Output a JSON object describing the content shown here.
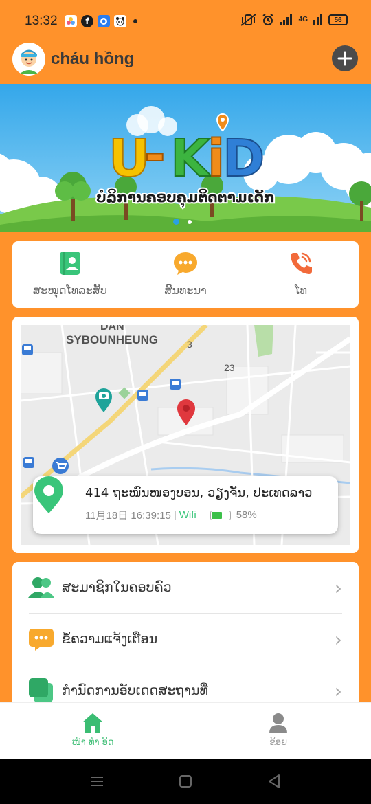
{
  "status_bar": {
    "time": "13:32",
    "app_icons": [
      "photos-app-icon",
      "facebook-icon",
      "messenger-app-icon",
      "panda-app-icon"
    ],
    "network": "4G",
    "battery": "56"
  },
  "header": {
    "child_name": "cháu hồng"
  },
  "banner": {
    "logo_text": "U-KiD",
    "tagline": "ບໍລິການຄອບຄຸມຕິດຕາມເດັກ",
    "active_slide": 1,
    "slide_count": 2
  },
  "quick_actions": [
    {
      "label": "ສະໝຸດໂທລະສັບ",
      "icon": "contacts-book-icon",
      "color": "#39c57a"
    },
    {
      "label": "ສົນທະນາ",
      "icon": "chat-bubble-icon",
      "color": "#f8a92d"
    },
    {
      "label": "ໂທ",
      "icon": "phone-icon",
      "color": "#f26a3a"
    }
  ],
  "map": {
    "labels": {
      "district": "DAN",
      "area": "SYBOUNHEUNG",
      "road_1": "3",
      "road_2": "23"
    },
    "location": {
      "address": "414 ຖະໜົນໜອງບອນ, ວຽງຈັນ, ປະເທດລາວ",
      "date": "11月18日 16:39:15",
      "separator": "|",
      "connection": "Wifi",
      "battery_level": 0.58,
      "battery_text": "58%"
    }
  },
  "menu": [
    {
      "label": "ສະມາຊິກໃນຄອບຄົວ",
      "icon": "family-members-icon"
    },
    {
      "label": "ຂໍ້ຄວາມແຈ້ງເຕືອນ",
      "icon": "notification-message-icon"
    },
    {
      "label": "ກຳນົດການອັບເດດສະຖານທີ່",
      "icon": "location-update-schedule-icon"
    }
  ],
  "bottom_nav": [
    {
      "label": "ໜ້າ ທຳ ອິດ",
      "icon": "home-icon",
      "active": true
    },
    {
      "label": "ຂ້ອຍ",
      "icon": "profile-icon",
      "active": false
    }
  ],
  "colors": {
    "accent": "#FF922B",
    "green": "#39c57a",
    "pin_red": "#e0383e"
  }
}
